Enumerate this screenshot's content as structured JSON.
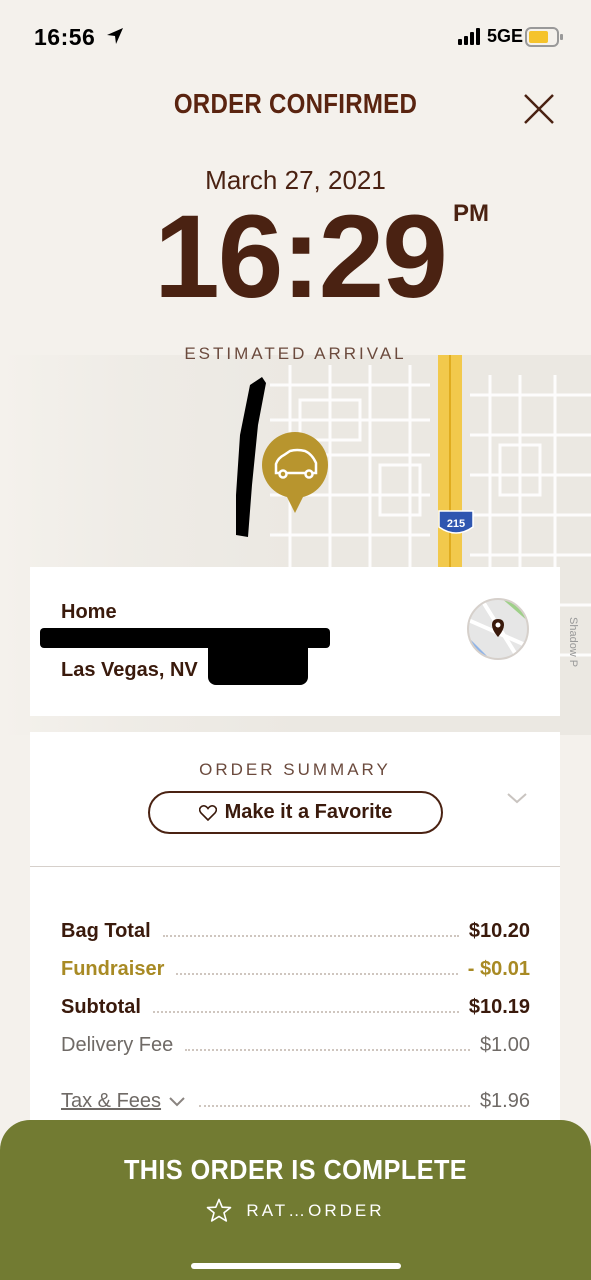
{
  "status_bar": {
    "time": "16:56",
    "network": "5GE"
  },
  "header": {
    "title": "ORDER CONFIRMED"
  },
  "arrival": {
    "date": "March 27, 2021",
    "time": "16:29",
    "ampm": "PM",
    "label": "ESTIMATED ARRIVAL"
  },
  "map": {
    "route_shield": "215",
    "street_label": "Shadow P",
    "marker_icon": "car-icon"
  },
  "address": {
    "label": "Home",
    "city": "Las Vegas, NV"
  },
  "summary": {
    "title": "ORDER SUMMARY",
    "favorite_label": "Make it a Favorite",
    "items": [
      {
        "label": "Bag Total",
        "value": "$10.20"
      },
      {
        "label": "Fundraiser",
        "value": "- $0.01"
      },
      {
        "label": "Subtotal",
        "value": "$10.19"
      },
      {
        "label": "Delivery Fee",
        "value": "$1.00"
      },
      {
        "label": "Tax & Fees",
        "value": "$1.96"
      }
    ]
  },
  "footer": {
    "title": "THIS ORDER IS COMPLETE",
    "rate_label": "RAT…ORDER"
  },
  "colors": {
    "brand_brown": "#4a2212",
    "gold": "#a88a24",
    "footer_green": "#727b32",
    "map_marker": "#b8952e"
  }
}
